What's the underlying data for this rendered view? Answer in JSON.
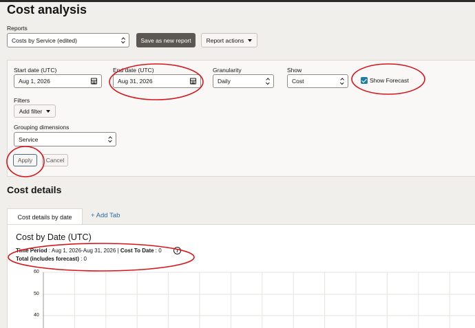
{
  "page": {
    "title": "Cost analysis"
  },
  "reports": {
    "label": "Reports",
    "selected": "Costs by Service (edited)",
    "save_label": "Save as new report",
    "actions_label": "Report actions"
  },
  "filters": {
    "start_date_label": "Start date (UTC)",
    "start_date_value": "Aug 1, 2026",
    "end_date_label": "End date (UTC)",
    "end_date_value": "Aug 31, 2026",
    "granularity_label": "Granularity",
    "granularity_value": "Daily",
    "show_label": "Show",
    "show_value": "Cost",
    "forecast_label": "Show Forecast",
    "forecast_checked": true,
    "filters_label": "Filters",
    "add_filter_label": "Add filter",
    "grouping_label": "Grouping dimensions",
    "grouping_value": "Service",
    "apply_label": "Apply",
    "cancel_label": "Cancel"
  },
  "details": {
    "section_title": "Cost details",
    "tabs": [
      {
        "label": "Cost details by date",
        "active": true
      }
    ],
    "add_tab_label": "+ Add Tab",
    "chart_title": "Cost by Date (UTC)",
    "time_period_label": "Time Period",
    "time_period_value": " : Aug 1, 2026-Aug 31, 2026 | ",
    "cost_to_date_label": "Cost To Date",
    "cost_to_date_value": " : 0",
    "total_label": "Total (includes forecast)",
    "total_value": " : 0",
    "y_ticks": [
      "60",
      "50",
      "40"
    ]
  },
  "colors": {
    "annotation": "#d9131a",
    "accent": "#227e9e",
    "link": "#2a6ba3",
    "dark_button": "#5b5752"
  }
}
